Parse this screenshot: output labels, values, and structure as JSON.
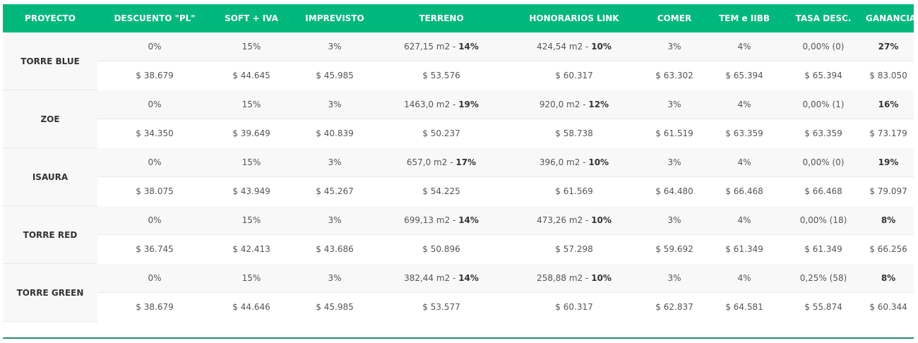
{
  "headers": [
    "PROYECTO",
    "DESCUENTO \"PL\"",
    "SOFT + IVA",
    "IMPREVISTO",
    "TERRENO",
    "HONORARIOS LINK",
    "COMER",
    "TEM e IIBB",
    "TASA DESC.",
    "GANANCIA"
  ],
  "projects": [
    {
      "name": "TORRE BLUE",
      "pct": {
        "descuento": "0%",
        "soft": "15%",
        "imprevisto": "3%",
        "terreno_m2": "627,15 m2",
        "terreno_pct": "14%",
        "honorarios_m2": "424,54 m2",
        "honorarios_pct": "10%",
        "comer": "3%",
        "tem": "4%",
        "tasa": "0,00% (0)",
        "ganancia": "27%"
      },
      "amt": {
        "descuento": "$ 38.679",
        "soft": "$ 44.645",
        "imprevisto": "$ 45.985",
        "terreno": "$ 53.576",
        "honorarios": "$ 60.317",
        "comer": "$ 63.302",
        "tem": "$ 65.394",
        "tasa": "$ 65.394",
        "ganancia": "$ 83.050"
      }
    },
    {
      "name": "ZOE",
      "pct": {
        "descuento": "0%",
        "soft": "15%",
        "imprevisto": "3%",
        "terreno_m2": "1463,0 m2",
        "terreno_pct": "19%",
        "honorarios_m2": "920,0 m2",
        "honorarios_pct": "12%",
        "comer": "3%",
        "tem": "4%",
        "tasa": "0,00% (1)",
        "ganancia": "16%"
      },
      "amt": {
        "descuento": "$ 34.350",
        "soft": "$ 39.649",
        "imprevisto": "$ 40.839",
        "terreno": "$ 50.237",
        "honorarios": "$ 58.738",
        "comer": "$ 61.519",
        "tem": "$ 63.359",
        "tasa": "$ 63.359",
        "ganancia": "$ 73.179"
      }
    },
    {
      "name": "ISAURA",
      "pct": {
        "descuento": "0%",
        "soft": "15%",
        "imprevisto": "3%",
        "terreno_m2": "657,0 m2",
        "terreno_pct": "17%",
        "honorarios_m2": "396,0 m2",
        "honorarios_pct": "10%",
        "comer": "3%",
        "tem": "4%",
        "tasa": "0,00% (0)",
        "ganancia": "19%"
      },
      "amt": {
        "descuento": "$ 38.075",
        "soft": "$ 43.949",
        "imprevisto": "$ 45.267",
        "terreno": "$ 54.225",
        "honorarios": "$ 61.569",
        "comer": "$ 64.480",
        "tem": "$ 66.468",
        "tasa": "$ 66.468",
        "ganancia": "$ 79.097"
      }
    },
    {
      "name": "TORRE RED",
      "pct": {
        "descuento": "0%",
        "soft": "15%",
        "imprevisto": "3%",
        "terreno_m2": "699,13 m2",
        "terreno_pct": "14%",
        "honorarios_m2": "473,26 m2",
        "honorarios_pct": "10%",
        "comer": "3%",
        "tem": "4%",
        "tasa": "0,00% (18)",
        "ganancia": "8%"
      },
      "amt": {
        "descuento": "$ 36.745",
        "soft": "$ 42.413",
        "imprevisto": "$ 43.686",
        "terreno": "$ 50.896",
        "honorarios": "$ 57.298",
        "comer": "$ 59.692",
        "tem": "$ 61.349",
        "tasa": "$ 61.349",
        "ganancia": "$ 66.256"
      }
    },
    {
      "name": "TORRE GREEN",
      "pct": {
        "descuento": "0%",
        "soft": "15%",
        "imprevisto": "3%",
        "terreno_m2": "382,44 m2",
        "terreno_pct": "14%",
        "honorarios_m2": "258,88 m2",
        "honorarios_pct": "10%",
        "comer": "3%",
        "tem": "4%",
        "tasa": "0,25% (58)",
        "ganancia": "8%"
      },
      "amt": {
        "descuento": "$ 38.679",
        "soft": "$ 44.646",
        "imprevisto": "$ 45.985",
        "terreno": "$ 53.577",
        "honorarios": "$ 60.317",
        "comer": "$ 62.837",
        "tem": "$ 64.581",
        "tasa": "$ 55.874",
        "ganancia": "$ 60.344"
      }
    }
  ],
  "colors": {
    "header_bg": "#00b87c",
    "header_text": "#ffffff",
    "bottom_rule": "#2c8a6e"
  }
}
